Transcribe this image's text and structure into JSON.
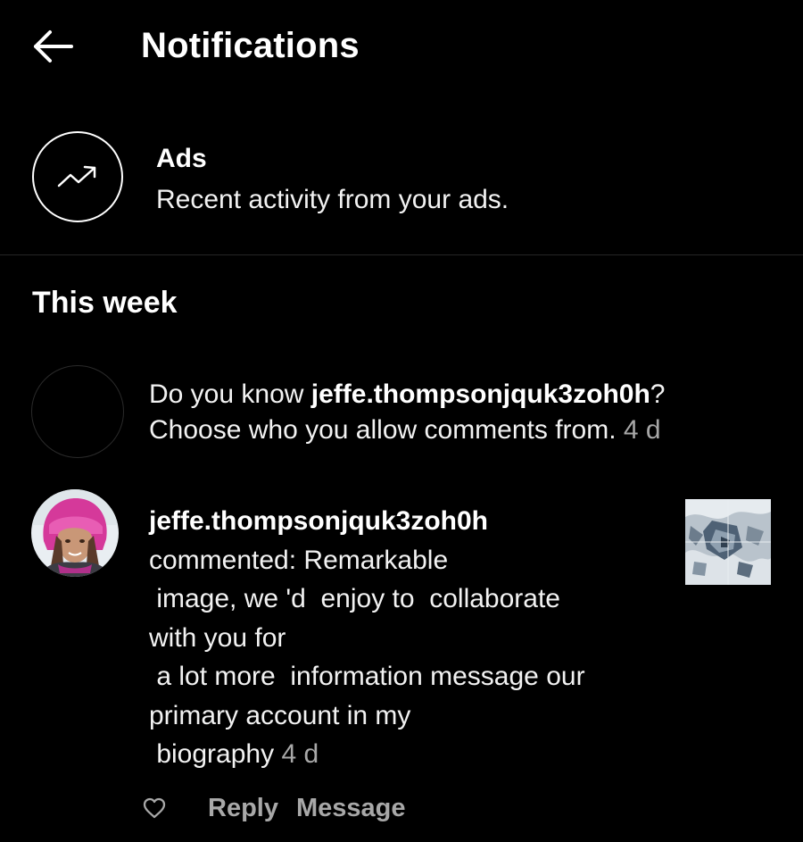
{
  "header": {
    "title": "Notifications",
    "back_icon": "arrow-left-icon"
  },
  "ads": {
    "title": "Ads",
    "subtitle": "Recent activity from your ads.",
    "icon": "trending-up-icon"
  },
  "section": {
    "title": "This week"
  },
  "suggestion": {
    "prefix": "Do you know ",
    "username": "jeffe.thompsonjquk3zoh0h",
    "suffix": "?",
    "line2": "Choose who you allow comments from.",
    "time": "4 d"
  },
  "comment": {
    "username": "jeffe.thompsonjquk3zoh0h",
    "lines": [
      "commented: Remarkable",
      " image, we 'd  enjoy to  collaborate",
      "with you for",
      " a lot more  information message our",
      "primary account in my",
      " biography"
    ],
    "time": "4 d"
  },
  "actions": {
    "like_icon": "heart-outline-icon",
    "reply": "Reply",
    "message": "Message"
  },
  "colors": {
    "background": "#000000",
    "text": "#ffffff",
    "secondary_text": "#a8a8a8",
    "divider": "#262626"
  }
}
